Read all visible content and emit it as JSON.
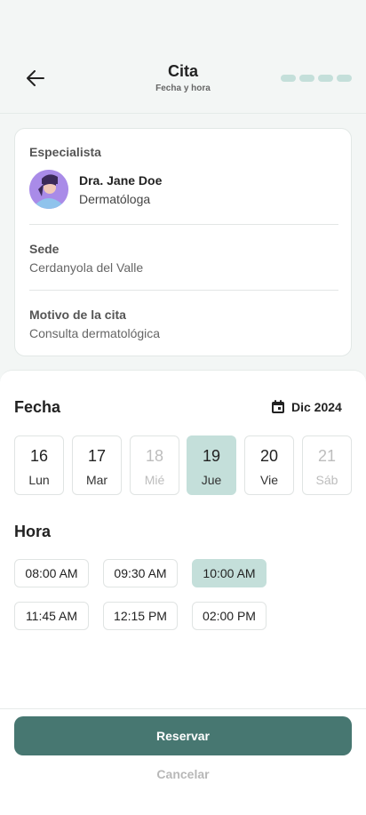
{
  "header": {
    "title": "Cita",
    "subtitle": "Fecha y hora",
    "progress_steps": 4
  },
  "summary": {
    "specialist_label": "Especialista",
    "doctor_name": "Dra. Jane Doe",
    "doctor_role": "Dermatóloga",
    "site_label": "Sede",
    "site_value": "Cerdanyola del Valle",
    "reason_label": "Motivo de la cita",
    "reason_value": "Consulta dermatológica"
  },
  "date_section": {
    "heading": "Fecha",
    "month": "Dic 2024",
    "days": [
      {
        "num": "16",
        "weekday": "Lun",
        "state": "available"
      },
      {
        "num": "17",
        "weekday": "Mar",
        "state": "available"
      },
      {
        "num": "18",
        "weekday": "Mié",
        "state": "disabled"
      },
      {
        "num": "19",
        "weekday": "Jue",
        "state": "selected"
      },
      {
        "num": "20",
        "weekday": "Vie",
        "state": "available"
      },
      {
        "num": "21",
        "weekday": "Sáb",
        "state": "disabled"
      }
    ]
  },
  "time_section": {
    "heading": "Hora",
    "slots": [
      {
        "label": "08:00 AM",
        "selected": false
      },
      {
        "label": "09:30 AM",
        "selected": false
      },
      {
        "label": "10:00 AM",
        "selected": true
      },
      {
        "label": "11:45 AM",
        "selected": false
      },
      {
        "label": "12:15 PM",
        "selected": false
      },
      {
        "label": "02:00 PM",
        "selected": false
      }
    ]
  },
  "actions": {
    "primary_label": "Reservar",
    "secondary_label": "Cancelar"
  },
  "colors": {
    "accent": "#477771",
    "accent_light": "#c4dfda",
    "background": "#f3f6f5"
  },
  "icons": {
    "back": "arrow-left-icon",
    "calendar": "calendar-icon"
  }
}
